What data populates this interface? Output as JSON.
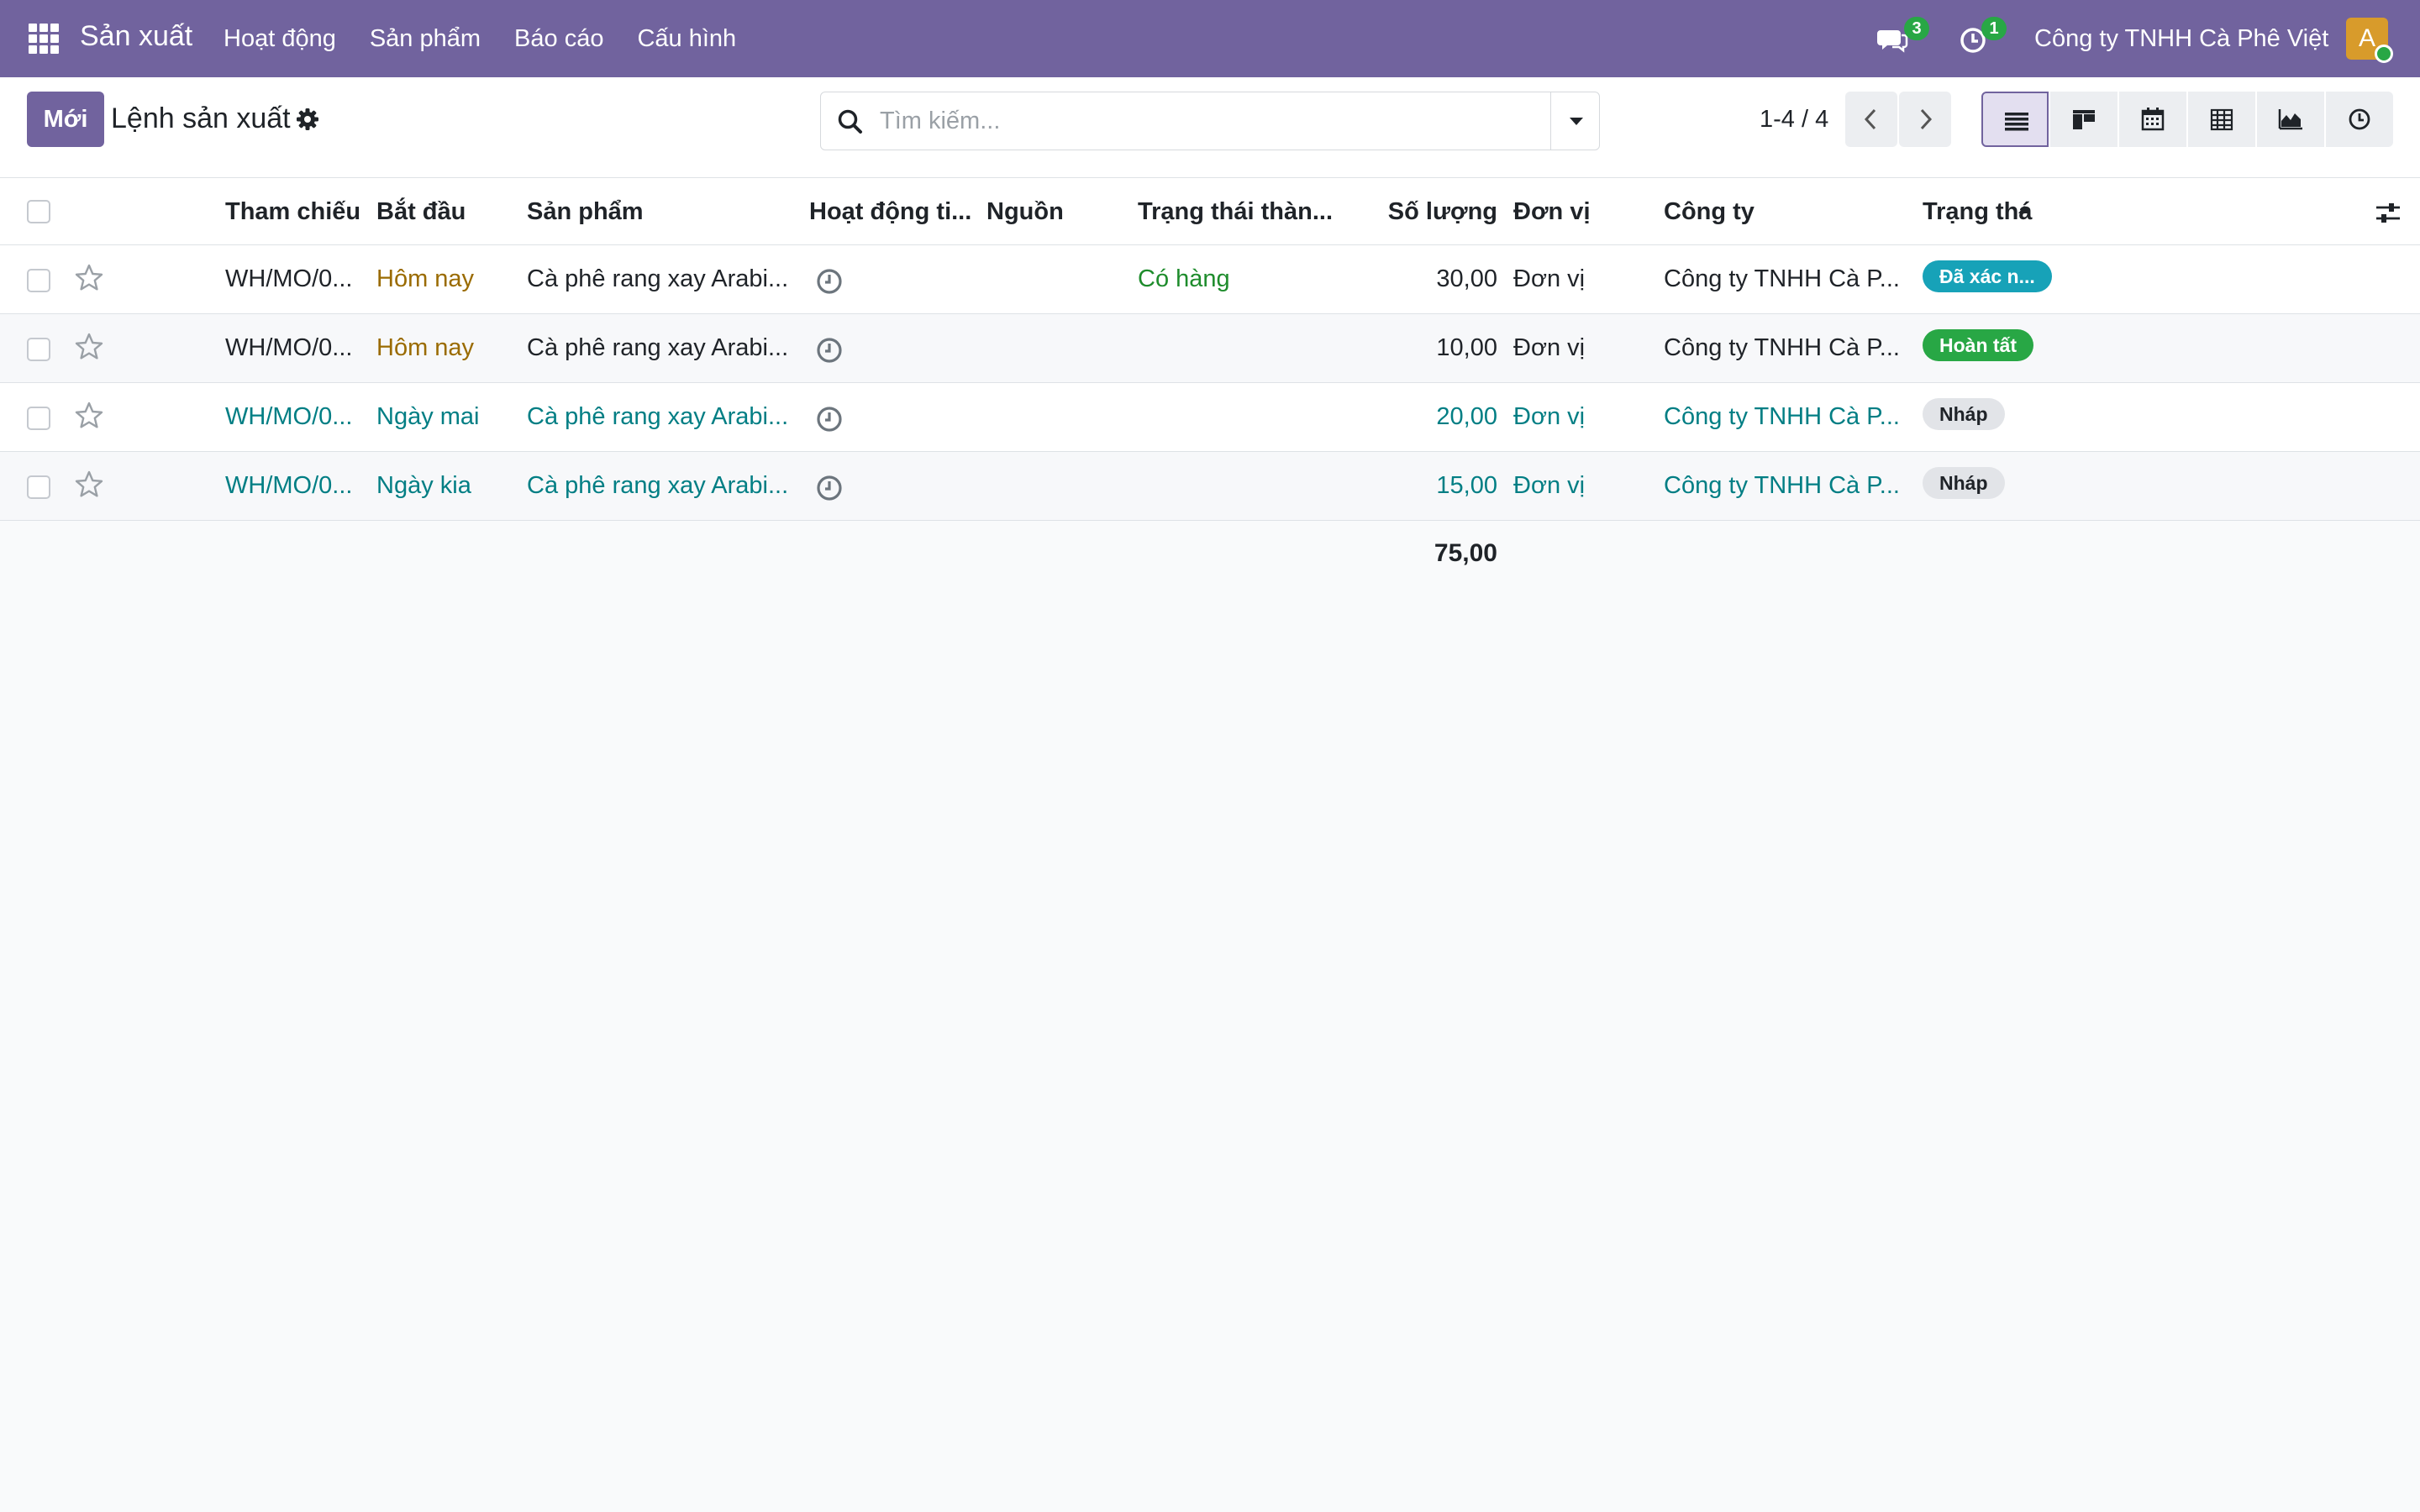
{
  "navbar": {
    "app_name": "Sản xuất",
    "menu": [
      "Hoạt động",
      "Sản phẩm",
      "Báo cáo",
      "Cấu hình"
    ],
    "messages_badge": "3",
    "activities_badge": "1",
    "company": "Công ty TNHH Cà Phê Việt",
    "avatar_letter": "A"
  },
  "control_panel": {
    "new_button": "Mới",
    "title": "Lệnh sản xuất",
    "search_placeholder": "Tìm kiếm...",
    "pager": "1-4 / 4"
  },
  "table": {
    "columns": [
      "Tham chiếu",
      "Bắt đầu",
      "Sản phẩm",
      "Hoạt động ti...",
      "Nguồn",
      "Trạng thái thàn...",
      "Số lượng",
      "Đơn vị",
      "Công ty",
      "Trạng thá"
    ],
    "rows": [
      {
        "ref": "WH/MO/0...",
        "start": "Hôm nay",
        "product": "Cà phê rang xay Arabi...",
        "source": "",
        "availability": "Có hàng",
        "qty": "30,00",
        "uom": "Đơn vị",
        "company": "Công ty TNHH Cà P...",
        "state": "Đã xác n..."
      },
      {
        "ref": "WH/MO/0...",
        "start": "Hôm nay",
        "product": "Cà phê rang xay Arabi...",
        "source": "",
        "availability": "",
        "qty": "10,00",
        "uom": "Đơn vị",
        "company": "Công ty TNHH Cà P...",
        "state": "Hoàn tất"
      },
      {
        "ref": "WH/MO/0...",
        "start": "Ngày mai",
        "product": "Cà phê rang xay Arabi...",
        "source": "",
        "availability": "",
        "qty": "20,00",
        "uom": "Đơn vị",
        "company": "Công ty TNHH Cà P...",
        "state": "Nháp"
      },
      {
        "ref": "WH/MO/0...",
        "start": "Ngày kia",
        "product": "Cà phê rang xay Arabi...",
        "source": "",
        "availability": "",
        "qty": "15,00",
        "uom": "Đơn vị",
        "company": "Công ty TNHH Cà P...",
        "state": "Nháp"
      }
    ],
    "total_qty": "75,00"
  },
  "colors": {
    "brand": "#71639e",
    "link": "#017e84",
    "warning_text": "#9a6b00",
    "success_text": "#1e8c2c"
  }
}
